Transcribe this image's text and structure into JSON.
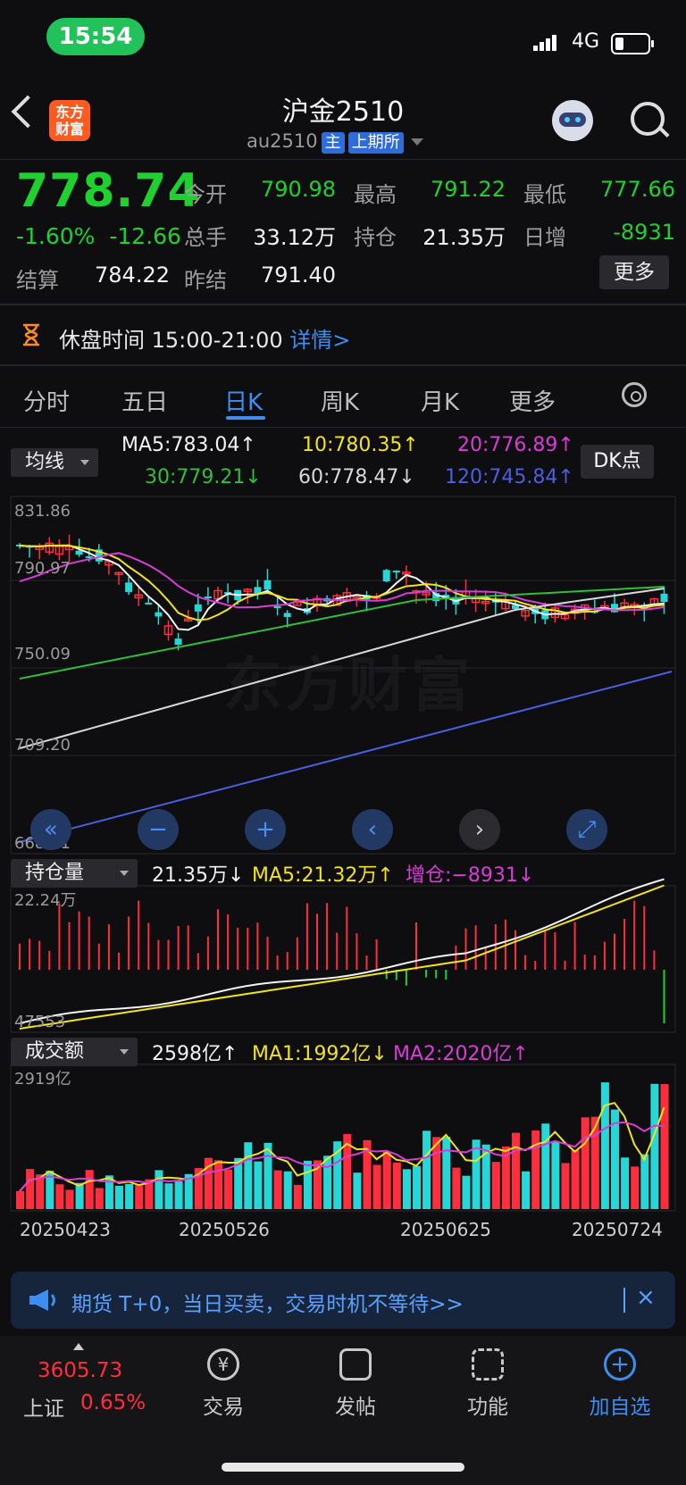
{
  "status_bar": {
    "time": "15:54",
    "network": "4G"
  },
  "header": {
    "logo_line1": "东方",
    "logo_line2": "财富",
    "title": "沪金2510",
    "code": "au2510",
    "tag_main": "主",
    "tag_exchange": "上期所"
  },
  "quote": {
    "price": "778.74",
    "change_pct": "-1.60%",
    "change_abs": "-12.66",
    "fields": [
      {
        "label": "今开",
        "value": "790.98"
      },
      {
        "label": "最高",
        "value": "791.22"
      },
      {
        "label": "最低",
        "value": "777.66"
      },
      {
        "label": "总手",
        "value": "33.12万"
      },
      {
        "label": "持仓",
        "value": "21.35万"
      },
      {
        "label": "日增",
        "value": "-8931"
      },
      {
        "label": "结算",
        "value": "784.22"
      },
      {
        "label": "昨结",
        "value": "791.40"
      }
    ],
    "more_label": "更多"
  },
  "notice": {
    "text": "休盘时间 15:00-21:00",
    "link": "详情>"
  },
  "tabs": [
    "分时",
    "五日",
    "日K",
    "周K",
    "月K",
    "更多"
  ],
  "ma_panel": {
    "selector": "均线",
    "ma5": "MA5:783.04↑",
    "ma10": "10:780.35↑",
    "ma20": "20:776.89↑",
    "ma30": "30:779.21↓",
    "ma60": "60:778.47↓",
    "ma120": "120:745.84↑",
    "dk_button": "DK点"
  },
  "price_axis": [
    "831.86",
    "790.97",
    "750.09",
    "709.20",
    "668.31"
  ],
  "watermark": "东方财富",
  "controls": [
    "«",
    "−",
    "+",
    "‹",
    "›",
    "⤢"
  ],
  "oi_panel": {
    "selector": "持仓量",
    "value": "21.35万↓",
    "ma5": "MA5:21.32万↑",
    "delta": "增仓:−8931↓",
    "axis_top": "22.24万",
    "axis_bottom": "47553"
  },
  "turnover_panel": {
    "selector": "成交额",
    "value": "2598亿↑",
    "ma1": "MA1:1992亿↓",
    "ma2": "MA2:2020亿↑",
    "axis_top": "2919亿"
  },
  "dates": [
    "20250423",
    "20250526",
    "20250625",
    "20250724"
  ],
  "banner": {
    "text": "期货 T+0，当日买卖，交易时机不等待>>",
    "close": "×"
  },
  "bottom_nav": {
    "index_value": "3605.73",
    "index_name": "上证",
    "index_change": "0.65%",
    "items": [
      "交易",
      "发帖",
      "功能",
      "加自选"
    ]
  },
  "colors": {
    "up": "#ff2d3d",
    "down": "#1fd12f",
    "accent": "#3d8ef0",
    "candle_down": "#27d7d7"
  }
}
